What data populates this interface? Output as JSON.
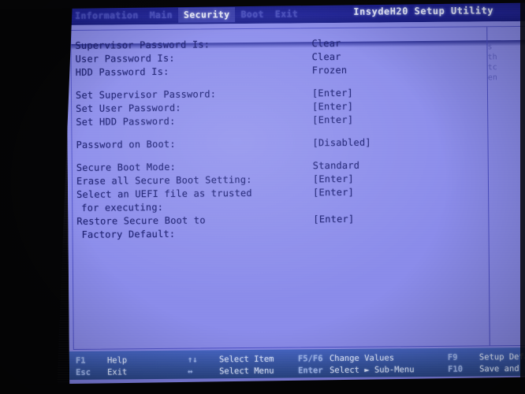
{
  "utility": {
    "title": "InsydeH20 Setup Utility"
  },
  "menu": {
    "tabs": [
      {
        "label": "Information",
        "selected": false
      },
      {
        "label": "Main",
        "selected": false
      },
      {
        "label": "Security",
        "selected": true
      },
      {
        "label": "Boot",
        "selected": false
      },
      {
        "label": "Exit",
        "selected": false
      }
    ]
  },
  "settings": {
    "rows": [
      {
        "label": "Supervisor Password Is:",
        "value": "Clear"
      },
      {
        "label": "User Password Is:",
        "value": "Clear"
      },
      {
        "label": "HDD Password Is:",
        "value": "Frozen"
      },
      {
        "label": "",
        "value": ""
      },
      {
        "label": "Set Supervisor Password:",
        "value": "[Enter]"
      },
      {
        "label": "Set User Password:",
        "value": "[Enter]"
      },
      {
        "label": "Set HDD Password:",
        "value": "[Enter]"
      },
      {
        "label": "",
        "value": ""
      },
      {
        "label": "Password on Boot:",
        "value": "[Disabled]"
      },
      {
        "label": "",
        "value": ""
      },
      {
        "label": "Secure Boot Mode:",
        "value": "Standard"
      },
      {
        "label": "Erase all Secure Boot Setting:",
        "value": "[Enter]"
      },
      {
        "label": "Select an UEFI file as trusted",
        "value": "[Enter]"
      },
      {
        "label": "for executing:",
        "value": ""
      },
      {
        "label": "Restore Secure Boot to",
        "value": "[Enter]"
      },
      {
        "label": "Factory Default:",
        "value": ""
      }
    ]
  },
  "help_pane": {
    "lines": [
      "s",
      "th",
      "tc",
      "en"
    ]
  },
  "keybar": {
    "columns": [
      [
        {
          "key": "F1",
          "desc": "Help"
        },
        {
          "key": "Esc",
          "desc": "Exit"
        }
      ],
      [
        {
          "key": "↑↓",
          "desc": "Select Item"
        },
        {
          "key": "↔",
          "desc": "Select Menu"
        }
      ],
      [
        {
          "key": "F5/F6",
          "desc": "Change Values"
        },
        {
          "key": "Enter",
          "desc": "Select ► Sub-Menu"
        }
      ],
      [
        {
          "key": "F9",
          "desc": "Setup Defaults"
        },
        {
          "key": "F10",
          "desc": "Save and Exit"
        }
      ]
    ]
  },
  "colors": {
    "menubar": "#1b1f8e",
    "menubar_selected": "#3b3fae",
    "panel_background": "#8a8bea",
    "panel_border": "#4f52c9",
    "text": "#191c6d",
    "keybar": "#3a5cba",
    "keybar_key": "#9fb6ee",
    "keybar_desc": "#dde6ff",
    "bezel": "#050506"
  }
}
